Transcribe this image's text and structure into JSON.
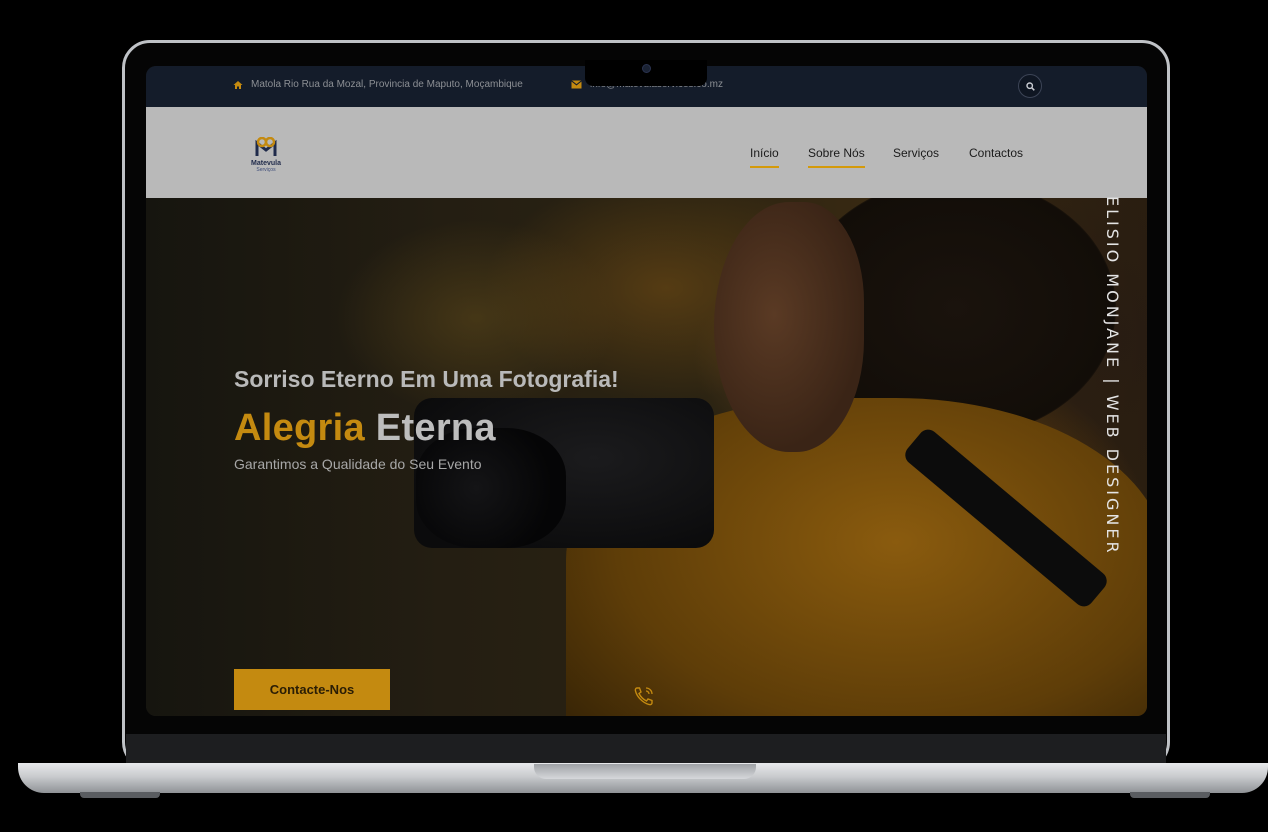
{
  "topbar": {
    "address": "Matola Rio Rua da Mozal, Provincia de Maputo, Moçambique",
    "email": "info@matevulaservices.co.mz"
  },
  "logo": {
    "name": "Matevula",
    "sub": "Serviços"
  },
  "nav": {
    "items": [
      {
        "label": "Início",
        "active": true
      },
      {
        "label": "Sobre Nós",
        "active": true
      },
      {
        "label": "Serviços",
        "active": false
      },
      {
        "label": "Contactos",
        "active": false
      }
    ]
  },
  "hero": {
    "subtitle": "Sorriso Eterno Em Uma Fotografia!",
    "headline_accent": "Alegria",
    "headline_rest": "Eterna",
    "tagline": "Garantimos a Qualidade do Seu Evento",
    "cta_label": "Contacte-Nos",
    "vertical_credit": "ELISIO MONJANE | WEB DESIGNER"
  },
  "colors": {
    "accent": "#c48a10",
    "topbar_bg": "#141c2a",
    "navbar_bg": "#b9b9b9"
  },
  "icons": [
    "home-icon",
    "envelope-icon",
    "search-icon",
    "phone-icon"
  ]
}
